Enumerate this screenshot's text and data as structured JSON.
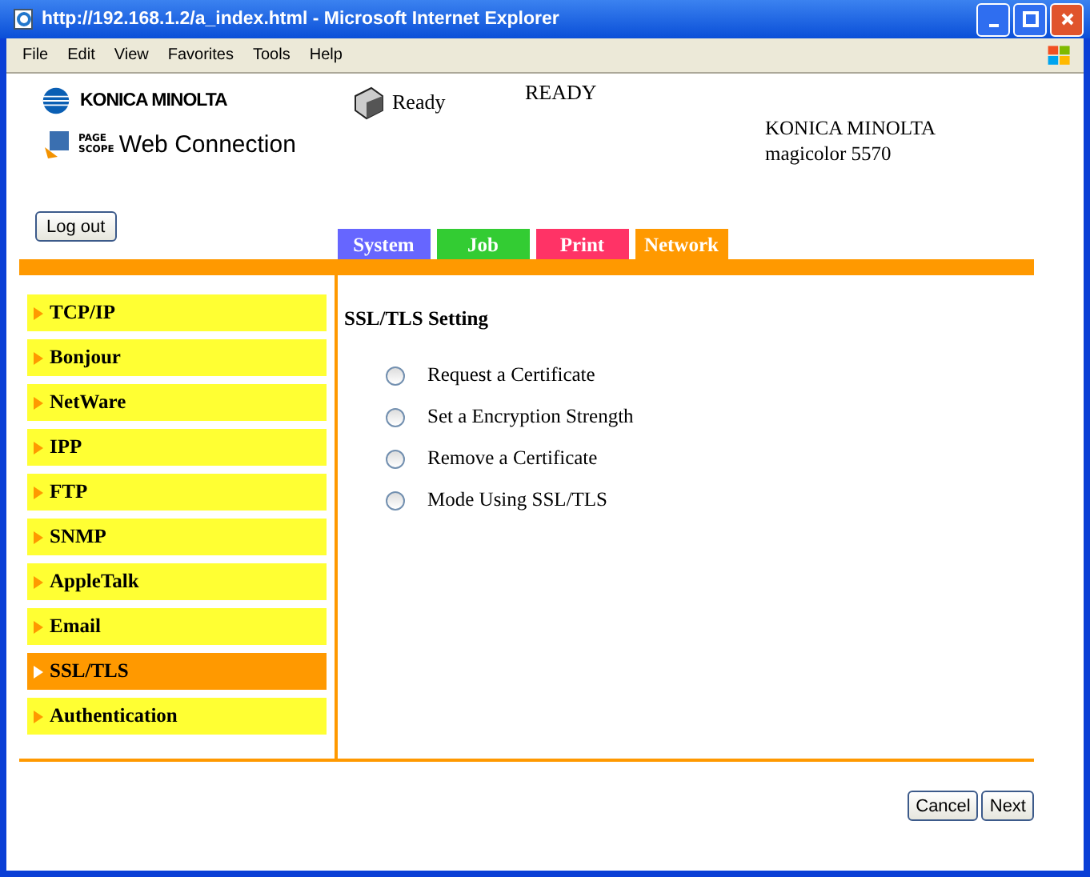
{
  "window": {
    "title": "http://192.168.1.2/a_index.html - Microsoft Internet Explorer"
  },
  "menu": [
    "File",
    "Edit",
    "View",
    "Favorites",
    "Tools",
    "Help"
  ],
  "header": {
    "brand": "KONICA MINOLTA",
    "product_logo_small": [
      "PAGE",
      "SCOPE"
    ],
    "product": "Web Connection",
    "printer_status": "Ready",
    "status": "READY",
    "model_lines": [
      "KONICA MINOLTA",
      "magicolor 5570"
    ]
  },
  "logout": "Log out",
  "tabs": [
    {
      "label": "System",
      "color": "#6666ff"
    },
    {
      "label": "Job",
      "color": "#33cc33"
    },
    {
      "label": "Print",
      "color": "#ff3366"
    },
    {
      "label": "Network",
      "color": "#ff9900"
    }
  ],
  "sidebar": {
    "items": [
      {
        "label": "TCP/IP",
        "selected": false
      },
      {
        "label": "Bonjour",
        "selected": false
      },
      {
        "label": "NetWare",
        "selected": false
      },
      {
        "label": "IPP",
        "selected": false
      },
      {
        "label": "FTP",
        "selected": false
      },
      {
        "label": "SNMP",
        "selected": false
      },
      {
        "label": "AppleTalk",
        "selected": false
      },
      {
        "label": "Email",
        "selected": false
      },
      {
        "label": "SSL/TLS",
        "selected": true
      },
      {
        "label": "Authentication",
        "selected": false
      }
    ]
  },
  "content": {
    "heading": "SSL/TLS Setting",
    "options": [
      {
        "label": "Request a Certificate",
        "checked": false
      },
      {
        "label": "Set a Encryption Strength",
        "checked": false
      },
      {
        "label": "Remove a Certificate",
        "checked": false
      },
      {
        "label": "Mode Using SSL/TLS",
        "checked": false
      }
    ]
  },
  "buttons": [
    "Cancel",
    "Next"
  ]
}
